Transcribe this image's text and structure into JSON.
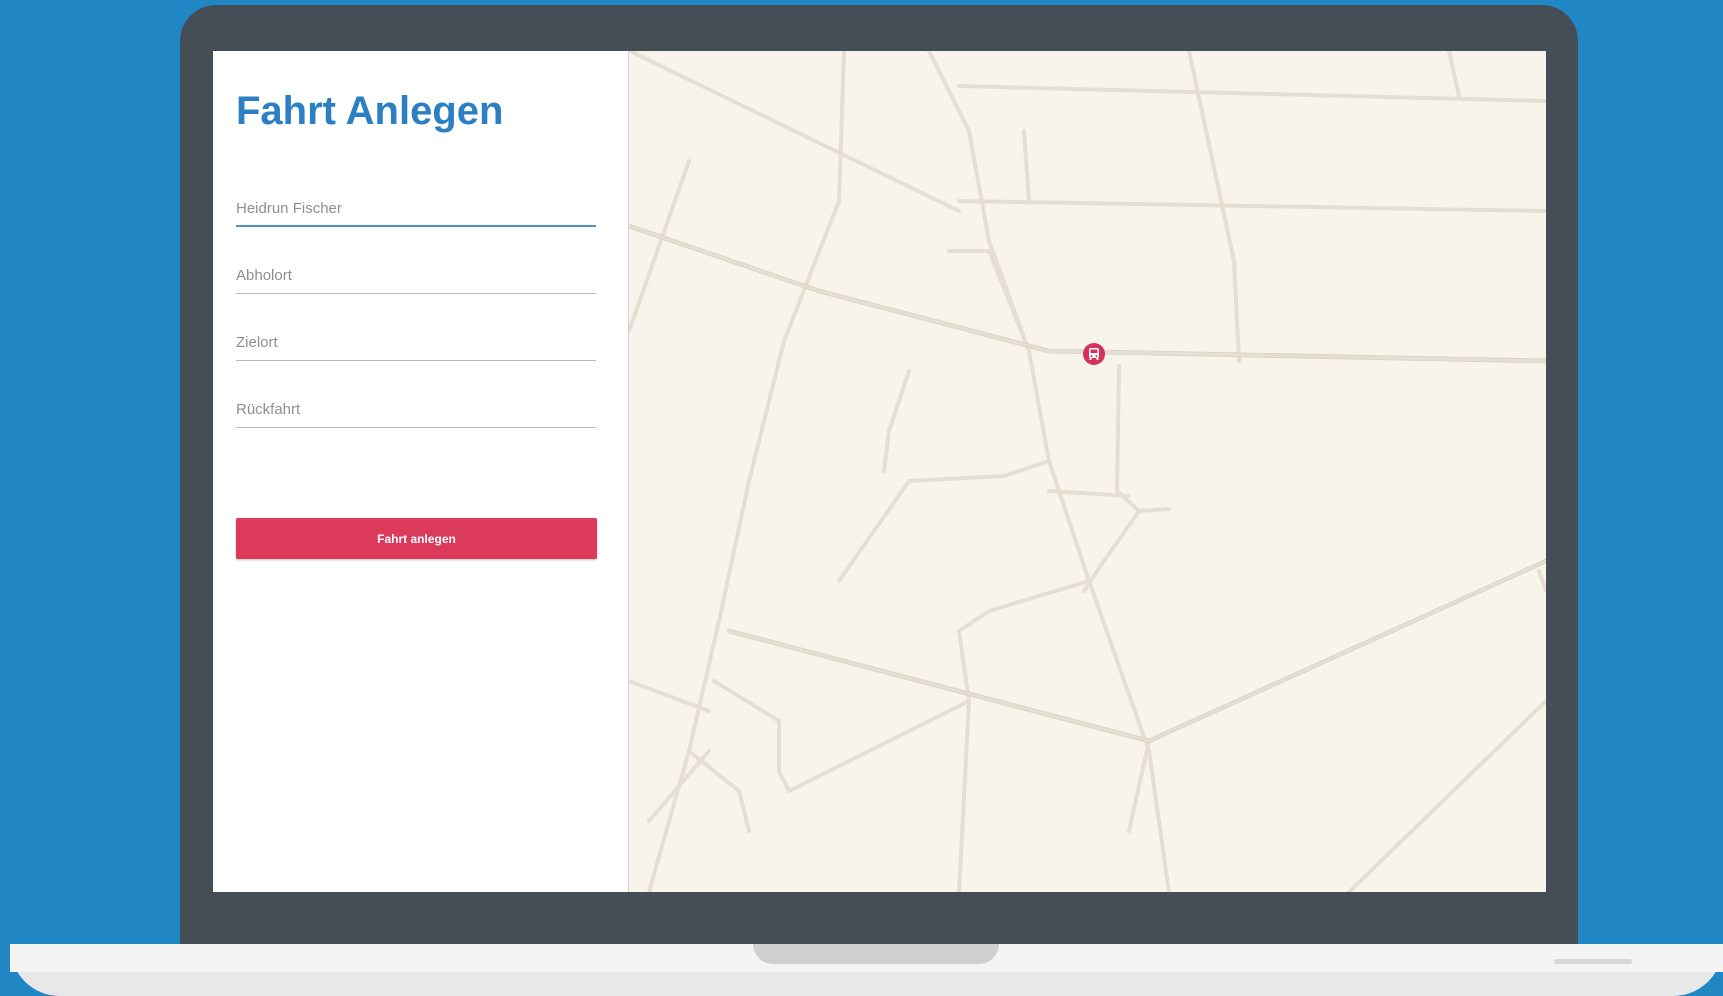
{
  "form": {
    "title": "Fahrt Anlegen",
    "fields": {
      "name": {
        "placeholder": "Heidrun Fischer",
        "value": ""
      },
      "pickup": {
        "placeholder": "Abholort",
        "value": ""
      },
      "destination": {
        "placeholder": "Zielort",
        "value": ""
      },
      "return_trip": {
        "placeholder": "Rückfahrt",
        "value": ""
      }
    },
    "submit_label": "Fahrt anlegen"
  },
  "map": {
    "marker_icon": "bus-icon",
    "colors": {
      "background": "#f8f4ec",
      "road": "#e6e0d5",
      "marker": "#d6315a"
    }
  },
  "colors": {
    "accent": "#2b7fc2",
    "button": "#db3a5b",
    "page_background": "#2186c4",
    "device": "#454d57"
  }
}
